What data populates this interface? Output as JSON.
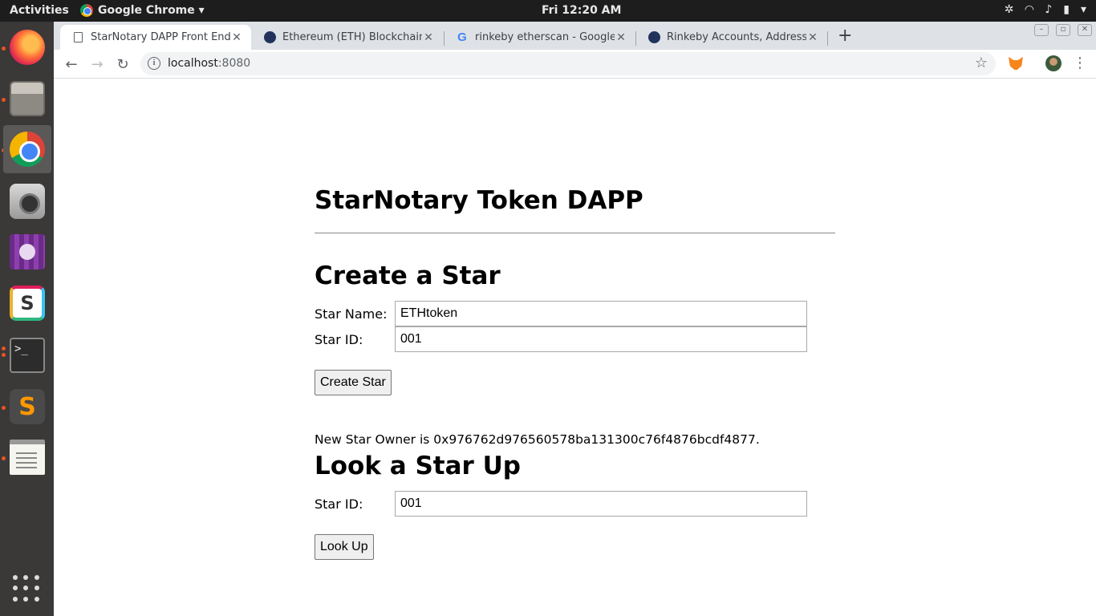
{
  "system": {
    "activities": "Activities",
    "app_menu": "Google Chrome ▾",
    "clock": "Fri 12:20 AM"
  },
  "dock": {
    "items": [
      "Firefox",
      "Files",
      "Google Chrome",
      "Cheese",
      "Video",
      "Slack",
      "Terminal",
      "Sublime Text",
      "Text Editor",
      "Show Applications"
    ]
  },
  "browser": {
    "tabs": [
      {
        "title": "StarNotary DAPP Front End",
        "favicon": "page-icon"
      },
      {
        "title": "Ethereum (ETH) Blockchain Explorer",
        "favicon": "etherscan-icon"
      },
      {
        "title": "rinkeby etherscan - Google Search",
        "favicon": "google-icon"
      },
      {
        "title": "Rinkeby Accounts, Addresses",
        "favicon": "etherscan-icon"
      }
    ],
    "url_host": "localhost",
    "url_port": ":8080"
  },
  "page": {
    "title": "StarNotary Token DAPP",
    "create": {
      "heading": "Create a Star",
      "name_label": "Star Name:",
      "name_value": "ETHtoken",
      "id_label": "Star ID:",
      "id_value": "001",
      "button": "Create Star"
    },
    "owner_message": "New Star Owner is 0x976762d976560578ba131300c76f4876bcdf4877.",
    "lookup": {
      "heading": "Look a Star Up",
      "id_label": "Star ID:",
      "id_value": "001",
      "button": "Look Up"
    }
  },
  "colors": {
    "dock_bg": "#3b3838",
    "topbar_bg": "#1d1d1d",
    "tabstrip_bg": "#dee1e6",
    "accent_dot": "#e95420"
  }
}
